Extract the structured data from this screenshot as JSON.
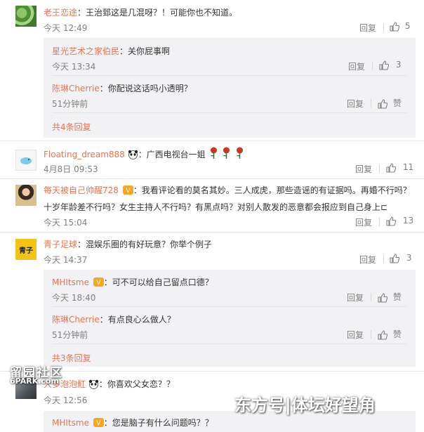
{
  "comments": [
    {
      "user": "老王恋途",
      "sep": "：",
      "text": "王治郅这是几混呀？！可能你也不知道。",
      "time": "今天 12:49",
      "reply": "回复",
      "likes": "5"
    },
    {
      "user": "Floating_dream888",
      "sep": "：",
      "text": "广西电视台一姐",
      "time": "4月8日 09:53",
      "reply": "回复",
      "likes": "11"
    },
    {
      "user": "每天被自己帅醒728",
      "sep": "：",
      "text": "我看评论看的莫名其妙。三人成虎，那些造谣的有证据吗。再婚不行吗？",
      "text2": "十岁年龄差不行吗？女生主持人不行吗？有黑点吗？对别人散发的恶意都会报应到自己身上⊏",
      "time": "今天 15:04",
      "reply": "回复",
      "likes": "13"
    },
    {
      "user": "青子足球",
      "sep": "：",
      "text": "混娱乐圈的有好玩意？你举个例子",
      "time": "今天 14:37",
      "reply": "回复",
      "likes": "3"
    },
    {
      "user": "大多泡泡魟",
      "sep": "：",
      "text": "你喜欢父女恋？？",
      "time": "今天 12:56"
    }
  ],
  "replies": [
    {
      "user": "星光艺术之家伯民",
      "sep": "：",
      "text": "关你屁事啊",
      "time": "今天 13:34",
      "reply": "回复",
      "likes": "3"
    },
    {
      "user": "陈琳Cherrie",
      "sep": "：",
      "text": "你配说这话吗小透明？",
      "time": "51分钟前",
      "reply": "回复",
      "likes": "赞"
    },
    {
      "user": "MHItsme",
      "sep": "：",
      "text": "可不可以给自己留点口德？",
      "time": "今天 18:40",
      "reply": "回复",
      "likes": "赞"
    },
    {
      "user": "陈琳Cherrie",
      "sep": "：",
      "text": "有点良心么做人？",
      "time": "51分钟前",
      "reply": "回复",
      "likes": "赞"
    },
    {
      "user": "MHItsme",
      "sep": "：",
      "text": "您是脑子有什么问题吗？？"
    }
  ],
  "more": [
    "共4条回复",
    "共3条回复"
  ],
  "watermarks": {
    "left_top": "留园社区",
    "left_bottom": "6PARK.com",
    "right": "东方号|体坛好望角"
  },
  "avatar_text": {
    "qingzi": "青子"
  },
  "colors": {
    "name": "#eb7350",
    "muted": "#808080",
    "reply_bg": "#f2f2f5",
    "rose": "#c0392b"
  }
}
